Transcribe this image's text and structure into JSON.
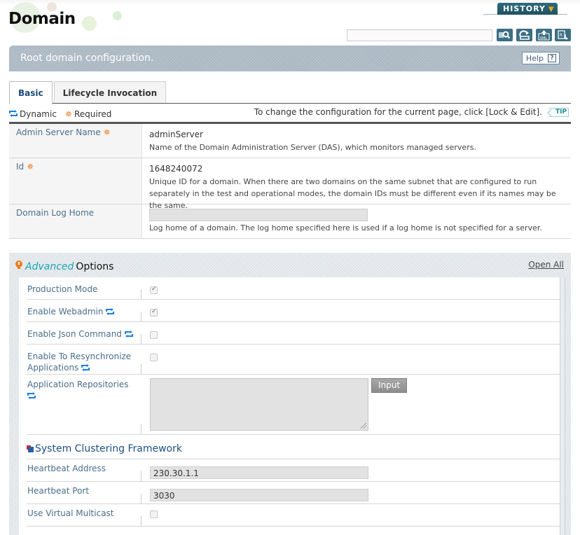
{
  "page": {
    "title": "Domain",
    "history_label": "HISTORY",
    "search": {
      "value": "",
      "placeholder": ""
    },
    "toolbar": [
      {
        "name": "search-icon"
      },
      {
        "name": "refresh-icon"
      },
      {
        "name": "xml-export-icon"
      },
      {
        "name": "report-icon"
      }
    ]
  },
  "banner": {
    "text": "Root domain configuration.",
    "help_label": "Help",
    "help_icon": "?"
  },
  "tabs": [
    {
      "label": "Basic",
      "active": true
    },
    {
      "label": "Lifecycle Invocation",
      "active": false
    }
  ],
  "legend": {
    "dynamic": "Dynamic",
    "required": "Required",
    "tip_text": "To change the configuration for the current page, click [Lock & Edit].",
    "tip_badge": "TIP"
  },
  "basic_fields": [
    {
      "label": "Admin Server Name",
      "required": true,
      "value": "adminServer",
      "description": "Name of the Domain Administration Server (DAS), which monitors managed servers."
    },
    {
      "label": "Id",
      "required": true,
      "value": "1648240072",
      "description": "Unique ID for a domain. When there are two domains on the same subnet that are configured to run separately in the test and operational modes, the domain IDs must be different even if its names may be the same."
    },
    {
      "label": "Domain Log Home",
      "required": false,
      "value": "",
      "description": "Log home of a domain. The log home specified here is used if a log home is not specified for a server."
    }
  ],
  "advanced": {
    "title_italic": "Advanced",
    "title_rest": "Options",
    "open_all": "Open All",
    "fields": [
      {
        "label": "Production Mode",
        "dynamic": false,
        "checked": true
      },
      {
        "label": "Enable Webadmin",
        "dynamic": true,
        "checked": true
      },
      {
        "label": "Enable Json Command",
        "dynamic": true,
        "checked": false
      },
      {
        "label": "Enable To Resynchronize Applications",
        "dynamic": true,
        "checked": false
      }
    ],
    "repositories": {
      "label": "Application Repositories",
      "dynamic": true,
      "value": "",
      "button": "Input"
    },
    "clustering": {
      "title": "System Clustering Framework",
      "heartbeat_address": {
        "label": "Heartbeat Address",
        "value": "230.30.1.1"
      },
      "heartbeat_port": {
        "label": "Heartbeat Port",
        "value": "3030"
      },
      "virtual_multicast": {
        "label": "Use Virtual Multicast",
        "checked": false
      }
    }
  },
  "colors": {
    "label_blue": "#4a6e8a",
    "required_orange": "#f07d1e",
    "dynamic_blue": "#1a7fe0",
    "accent_teal": "#1aa7b8",
    "history_bg": "#2f6b7c"
  }
}
